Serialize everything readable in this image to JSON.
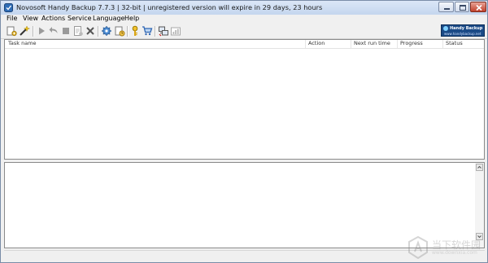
{
  "window": {
    "title": "Novosoft Handy Backup 7.7.3 | 32-bit | unregistered version will expire in  29 days, 23 hours"
  },
  "menu": [
    {
      "label": "File"
    },
    {
      "label": "View"
    },
    {
      "label": "Actions"
    },
    {
      "label": "Service"
    },
    {
      "label": "Language"
    },
    {
      "label": "Help"
    }
  ],
  "toolbar": {
    "icons": [
      "new-task-icon",
      "wizard-icon",
      "run-icon",
      "restore-icon",
      "stop-icon",
      "properties-icon",
      "delete-icon",
      "settings-icon",
      "scheduler-icon",
      "register-icon",
      "buy-icon",
      "network-icon",
      "stats-icon"
    ]
  },
  "logo": {
    "title": "Handy Backup",
    "url": "www.handybackup.net"
  },
  "tasks": {
    "columns": [
      "Task name",
      "Action",
      "Next run time",
      "Progress",
      "Status"
    ],
    "rows": []
  },
  "watermark": {
    "text": "当下软件园",
    "url": "www.downxia.com"
  },
  "colors": {
    "logo_bg": "#1b4a86",
    "close_button": "#c1412b",
    "title_bar": "#c4d6ee"
  }
}
